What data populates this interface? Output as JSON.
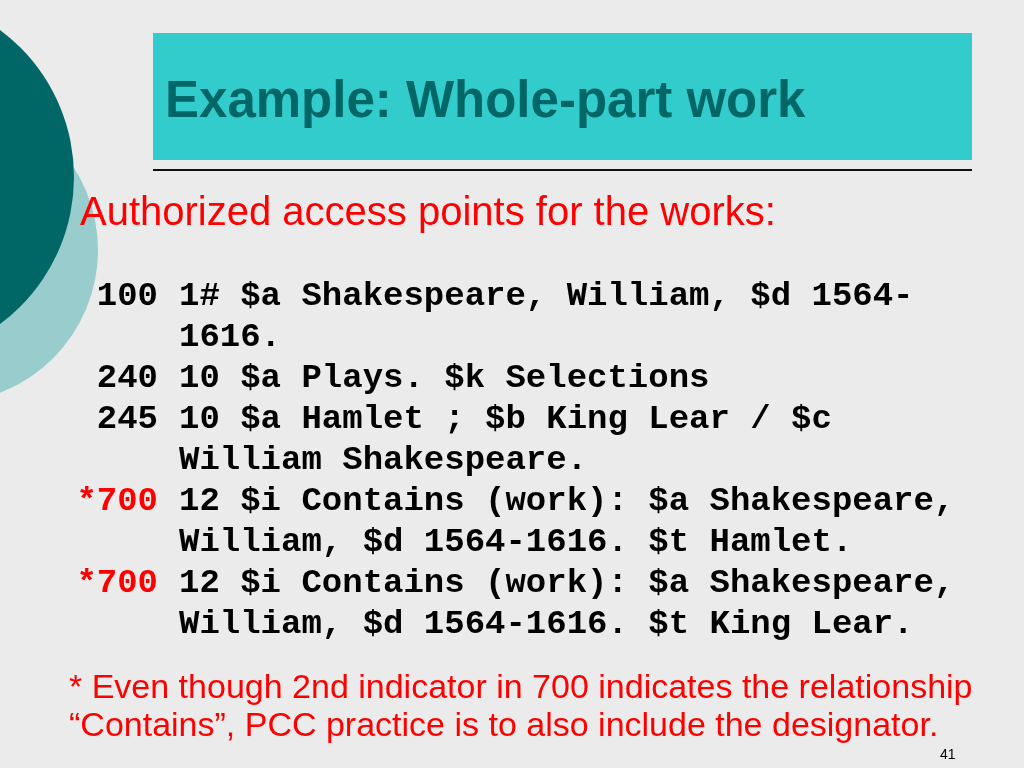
{
  "slide": {
    "title": "Example: Whole-part work",
    "subtitle": "Authorized access points for the works:",
    "fields": [
      {
        "tag": "100",
        "color": "#000000",
        "lines": [
          "1# $a Shakespeare, William, $d 1564-",
          "1616."
        ]
      },
      {
        "tag": "240",
        "color": "#000000",
        "lines": [
          "10 $a Plays. $k Selections"
        ]
      },
      {
        "tag": "245",
        "color": "#000000",
        "lines": [
          "10 $a Hamlet ; $b King Lear / $c",
          "William Shakespeare."
        ]
      },
      {
        "tag": "*700",
        "color": "#ff0000",
        "lines": [
          "12 $i Contains (work): $a Shakespeare,",
          "William, $d 1564-1616. $t Hamlet."
        ]
      },
      {
        "tag": "*700",
        "color": "#ff0000",
        "lines": [
          "12 $i Contains (work): $a Shakespeare,",
          "William, $d 1564-1616. $t King Lear."
        ]
      }
    ],
    "footnote": "* Even though 2nd indicator in 700 indicates the relationship “Contains”, PCC practice is to also include the designator.",
    "page_number": "41"
  }
}
